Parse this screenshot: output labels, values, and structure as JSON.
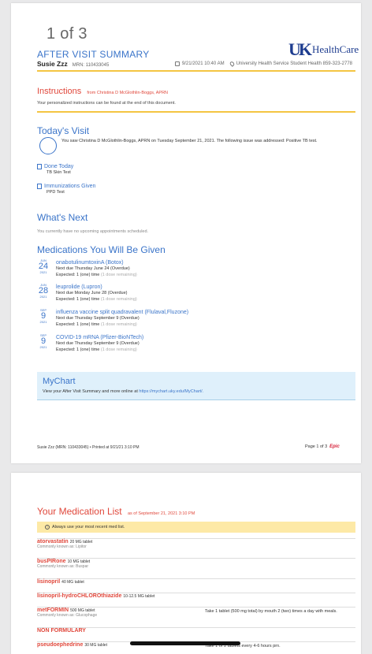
{
  "page_counter": "1 of 3",
  "header": {
    "title": "AFTER VISIT SUMMARY",
    "logo_mark": "UK",
    "logo_text": "HealthCare",
    "patient_name": "Susie Zzz",
    "mrn": "MRN: 110433045",
    "visit_datetime": "9/21/2021 10:40 AM",
    "location": "University Health Service Student Health 859-323-2778"
  },
  "instructions": {
    "title": "Instructions",
    "from": "from Christina D McGlothlin-Boggs, APRN",
    "text": "Your personalized instructions can be found at the end of this document."
  },
  "todays_visit": {
    "title": "Today's Visit",
    "text": "You saw Christina D McGlothlin-Boggs, APRN on Tuesday September 21, 2021. The following issue was addressed: Positive TB test.",
    "done_today": {
      "label": "Done Today",
      "item": "TB Skin Test"
    },
    "immunizations": {
      "label": "Immunizations Given",
      "item": "PPD Test"
    }
  },
  "whats_next": {
    "title": "What's Next",
    "text": "You currently have no upcoming appointments scheduled."
  },
  "medications_given": {
    "title": "Medications You Will Be Given",
    "items": [
      {
        "month": "JUN",
        "day": "24",
        "year": "2021",
        "name": "onabotulinumtoxinA (Botox)",
        "due": "Next due Thursday June 24 (Overdue)",
        "expected": "Expected: 1 (one) time",
        "remaining": "(1 dose remaining)"
      },
      {
        "month": "JUN",
        "day": "28",
        "year": "2021",
        "name": "leuprolide (Lupron)",
        "due": "Next due Monday June 28 (Overdue)",
        "expected": "Expected: 1 (one) time",
        "remaining": "(1 dose remaining)"
      },
      {
        "month": "SEP",
        "day": "9",
        "year": "2021",
        "name": "influenza vaccine split quadravalent (Flulaval,Fluzone)",
        "due": "Next due Thursday September 9 (Overdue)",
        "expected": "Expected: 1 (one) time",
        "remaining": "(1 dose remaining)"
      },
      {
        "month": "SEP",
        "day": "9",
        "year": "2021",
        "name": "COVID-19 mRNA (Pfizer-BioNTech)",
        "due": "Next due Thursday September 9 (Overdue)",
        "expected": "Expected: 1 (one) time",
        "remaining": "(1 dose remaining)"
      }
    ]
  },
  "mychart": {
    "title": "MyChart",
    "text": "View your After Visit Summary and more online at",
    "link": "https://mychart.uky.edu/MyChart/."
  },
  "footer": {
    "left": "Susie Zzz (MRN: 110433045) • Printed at 9/21/21  3:10 PM",
    "right": "Page 1 of 3",
    "epic": "Epic"
  },
  "medication_list": {
    "title": "Your Medication List",
    "as_of": "as of September 21, 2021  3:10 PM",
    "alert": "Always use your most recent med list.",
    "items": [
      {
        "name": "atorvastatin",
        "dose": "20 MG tablet",
        "aka": "Commonly known as: Lipitor",
        "instructions": ""
      },
      {
        "name": "busPIRone",
        "dose": "10 MG tablet",
        "aka": "Commonly known as: Buspar",
        "instructions": ""
      },
      {
        "name": "lisinopril",
        "dose": "40 MG tablet",
        "aka": "",
        "instructions": ""
      },
      {
        "name": "lisinopril-hydroCHLOROthiazide",
        "dose": "10-12.5 MG tablet",
        "aka": "",
        "instructions": ""
      },
      {
        "name": "metFORMIN",
        "dose": "500 MG tablet",
        "aka": "Commonly known as: Glucophage",
        "instructions": "Take 1 tablet (500 mg total) by mouth 2 (two) times a day with meals."
      },
      {
        "name": "NON FORMULARY",
        "dose": "",
        "aka": "",
        "instructions": ""
      },
      {
        "name": "pseudoephedrine",
        "dose": "30 MG tablet",
        "aka": "",
        "instructions": "Take 1 or 2 tablets every 4-6 hours prn."
      }
    ]
  }
}
